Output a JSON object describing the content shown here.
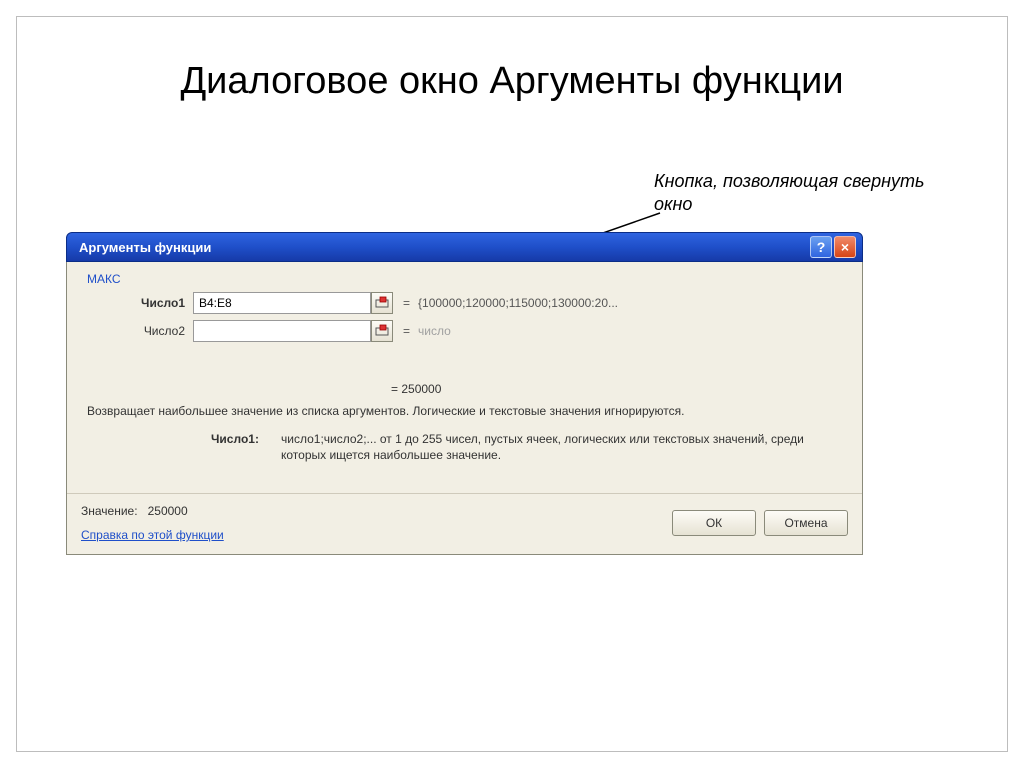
{
  "page": {
    "title": "Диалоговое окно Аргументы функции",
    "annotation": "Кнопка, позволяющая свернуть окно"
  },
  "dialog": {
    "title": "Аргументы функции",
    "function_name": "МАКС",
    "args": [
      {
        "label": "Число1",
        "value": "B4:E8",
        "preview": "{100000;120000;115000;130000:20..."
      },
      {
        "label": "Число2",
        "value": "",
        "preview": "число"
      }
    ],
    "result_prefix": "= ",
    "result_value": "250000",
    "description": "Возвращает наибольшее значение из списка аргументов. Логические и текстовые значения игнорируются.",
    "arg_help_label": "Число1:",
    "arg_help_text": "число1;число2;... от 1 до 255 чисел, пустых ячеек, логических или текстовых значений, среди которых ищется наибольшее значение.",
    "value_label": "Значение:",
    "value_result": "250000",
    "help_link": "Справка по этой функции",
    "ok_label": "ОК",
    "cancel_label": "Отмена"
  }
}
